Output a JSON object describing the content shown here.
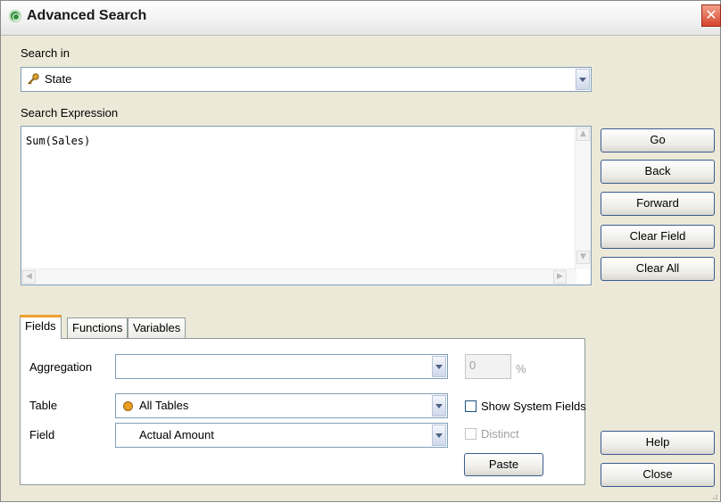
{
  "window": {
    "title": "Advanced Search",
    "close_glyph": "✕"
  },
  "search_in": {
    "label": "Search in",
    "value": "State",
    "icon": "key-icon"
  },
  "expression": {
    "label": "Search Expression",
    "value": "Sum(Sales)"
  },
  "buttons": {
    "go": "Go",
    "back": "Back",
    "forward": "Forward",
    "clear_field": "Clear Field",
    "clear_all": "Clear All",
    "help": "Help",
    "close": "Close",
    "paste": "Paste"
  },
  "tabs": [
    {
      "label": "Fields",
      "active": true
    },
    {
      "label": "Functions",
      "active": false
    },
    {
      "label": "Variables",
      "active": false
    }
  ],
  "fields_tab": {
    "aggregation_label": "Aggregation",
    "aggregation_value": "",
    "percent_value": "0",
    "percent_symbol": "%",
    "table_label": "Table",
    "table_value": "All Tables",
    "field_label": "Field",
    "field_value": "Actual Amount",
    "show_system_fields": "Show System Fields",
    "distinct": "Distinct"
  },
  "colors": {
    "accent_tab": "#f0a030",
    "title_icon": "#2f8f3a",
    "close_button": "#d6432d",
    "table_dot": "#e8a020"
  }
}
